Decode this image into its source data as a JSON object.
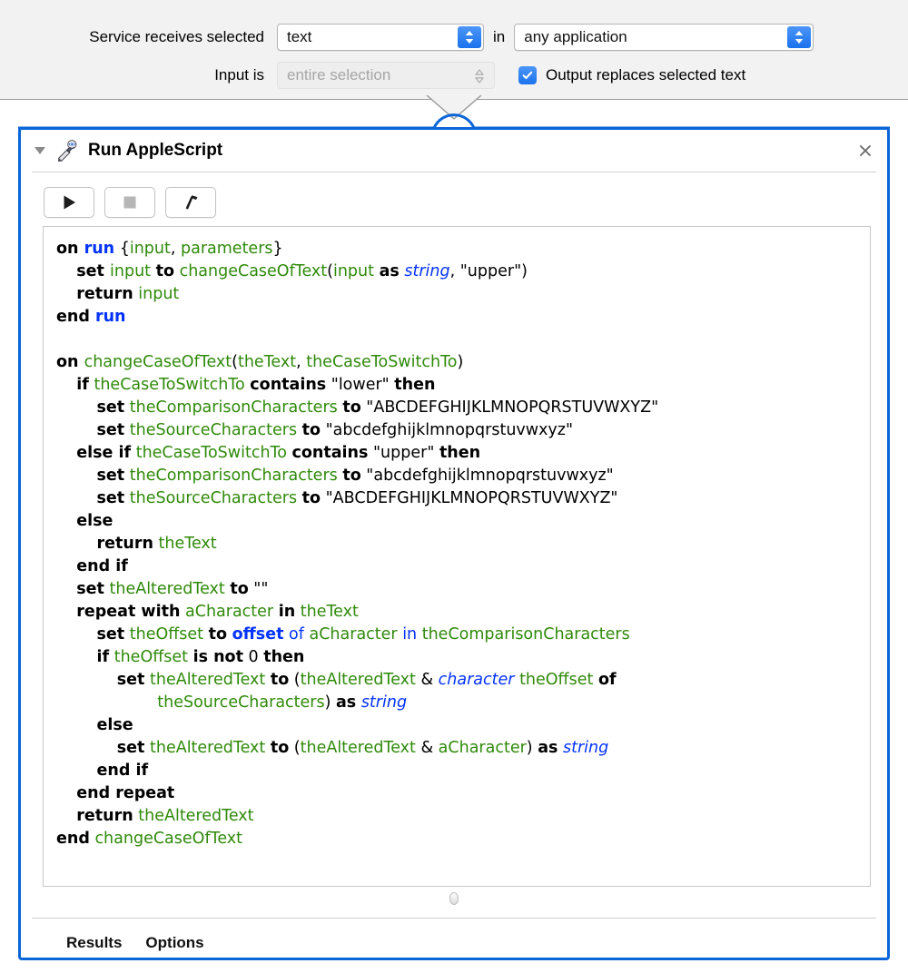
{
  "config": {
    "receives_label": "Service receives selected",
    "receives_value": "text",
    "in_label": "in",
    "application_value": "any application",
    "input_is_label": "Input is",
    "input_is_value": "entire selection",
    "output_checkbox_label": "Output replaces selected text",
    "output_checkbox_checked": true,
    "accent_color": "#1b73ee"
  },
  "panel": {
    "title": "Run AppleScript",
    "icon": "applescript-icon",
    "disclosure": "disclosure-triangle-open",
    "close_label": "✕",
    "border_color": "#0a65d8",
    "toolbar": [
      {
        "name": "run-button",
        "icon": "play-icon",
        "enabled": true
      },
      {
        "name": "stop-button",
        "icon": "stop-icon",
        "enabled": false
      },
      {
        "name": "compile-button",
        "icon": "hammer-icon",
        "enabled": true
      }
    ],
    "footer_tabs": [
      {
        "label": "Results"
      },
      {
        "label": "Options"
      }
    ]
  },
  "code": {
    "language": "AppleScript",
    "lines": [
      [
        {
          "t": "on ",
          "c": "kw"
        },
        {
          "t": "run",
          "c": "bkw"
        },
        {
          "t": " {",
          "c": "plain"
        },
        {
          "t": "input",
          "c": "var"
        },
        {
          "t": ", ",
          "c": "plain"
        },
        {
          "t": "parameters",
          "c": "var"
        },
        {
          "t": "}",
          "c": "plain"
        }
      ],
      [
        {
          "t": "    ",
          "c": "plain"
        },
        {
          "t": "set ",
          "c": "kw"
        },
        {
          "t": "input",
          "c": "var"
        },
        {
          "t": " ",
          "c": "plain"
        },
        {
          "t": "to",
          "c": "kw"
        },
        {
          "t": " ",
          "c": "plain"
        },
        {
          "t": "changeCaseOfText",
          "c": "var"
        },
        {
          "t": "(",
          "c": "plain"
        },
        {
          "t": "input",
          "c": "var"
        },
        {
          "t": " ",
          "c": "plain"
        },
        {
          "t": "as",
          "c": "kw"
        },
        {
          "t": " ",
          "c": "plain"
        },
        {
          "t": "string",
          "c": "bit"
        },
        {
          "t": ", \"upper\")",
          "c": "plain"
        }
      ],
      [
        {
          "t": "    ",
          "c": "plain"
        },
        {
          "t": "return",
          "c": "kw"
        },
        {
          "t": " ",
          "c": "plain"
        },
        {
          "t": "input",
          "c": "var"
        }
      ],
      [
        {
          "t": "end ",
          "c": "kw"
        },
        {
          "t": "run",
          "c": "bkw"
        }
      ],
      [
        {
          "t": "",
          "c": "plain"
        }
      ],
      [
        {
          "t": "on ",
          "c": "kw"
        },
        {
          "t": "changeCaseOfText",
          "c": "var"
        },
        {
          "t": "(",
          "c": "plain"
        },
        {
          "t": "theText",
          "c": "var"
        },
        {
          "t": ", ",
          "c": "plain"
        },
        {
          "t": "theCaseToSwitchTo",
          "c": "var"
        },
        {
          "t": ")",
          "c": "plain"
        }
      ],
      [
        {
          "t": "    ",
          "c": "plain"
        },
        {
          "t": "if",
          "c": "kw"
        },
        {
          "t": " ",
          "c": "plain"
        },
        {
          "t": "theCaseToSwitchTo",
          "c": "var"
        },
        {
          "t": " ",
          "c": "plain"
        },
        {
          "t": "contains",
          "c": "kw"
        },
        {
          "t": " \"lower\" ",
          "c": "plain"
        },
        {
          "t": "then",
          "c": "kw"
        }
      ],
      [
        {
          "t": "        ",
          "c": "plain"
        },
        {
          "t": "set",
          "c": "kw"
        },
        {
          "t": " ",
          "c": "plain"
        },
        {
          "t": "theComparisonCharacters",
          "c": "var"
        },
        {
          "t": " ",
          "c": "plain"
        },
        {
          "t": "to",
          "c": "kw"
        },
        {
          "t": " \"ABCDEFGHIJKLMNOPQRSTUVWXYZ\"",
          "c": "plain"
        }
      ],
      [
        {
          "t": "        ",
          "c": "plain"
        },
        {
          "t": "set",
          "c": "kw"
        },
        {
          "t": " ",
          "c": "plain"
        },
        {
          "t": "theSourceCharacters",
          "c": "var"
        },
        {
          "t": " ",
          "c": "plain"
        },
        {
          "t": "to",
          "c": "kw"
        },
        {
          "t": " \"abcdefghijklmnopqrstuvwxyz\"",
          "c": "plain"
        }
      ],
      [
        {
          "t": "    ",
          "c": "plain"
        },
        {
          "t": "else if",
          "c": "kw"
        },
        {
          "t": " ",
          "c": "plain"
        },
        {
          "t": "theCaseToSwitchTo",
          "c": "var"
        },
        {
          "t": " ",
          "c": "plain"
        },
        {
          "t": "contains",
          "c": "kw"
        },
        {
          "t": " \"upper\" ",
          "c": "plain"
        },
        {
          "t": "then",
          "c": "kw"
        }
      ],
      [
        {
          "t": "        ",
          "c": "plain"
        },
        {
          "t": "set",
          "c": "kw"
        },
        {
          "t": " ",
          "c": "plain"
        },
        {
          "t": "theComparisonCharacters",
          "c": "var"
        },
        {
          "t": " ",
          "c": "plain"
        },
        {
          "t": "to",
          "c": "kw"
        },
        {
          "t": " \"abcdefghijklmnopqrstuvwxyz\"",
          "c": "plain"
        }
      ],
      [
        {
          "t": "        ",
          "c": "plain"
        },
        {
          "t": "set",
          "c": "kw"
        },
        {
          "t": " ",
          "c": "plain"
        },
        {
          "t": "theSourceCharacters",
          "c": "var"
        },
        {
          "t": " ",
          "c": "plain"
        },
        {
          "t": "to",
          "c": "kw"
        },
        {
          "t": " \"ABCDEFGHIJKLMNOPQRSTUVWXYZ\"",
          "c": "plain"
        }
      ],
      [
        {
          "t": "    ",
          "c": "plain"
        },
        {
          "t": "else",
          "c": "kw"
        }
      ],
      [
        {
          "t": "        ",
          "c": "plain"
        },
        {
          "t": "return",
          "c": "kw"
        },
        {
          "t": " ",
          "c": "plain"
        },
        {
          "t": "theText",
          "c": "var"
        }
      ],
      [
        {
          "t": "    ",
          "c": "plain"
        },
        {
          "t": "end if",
          "c": "kw"
        }
      ],
      [
        {
          "t": "    ",
          "c": "plain"
        },
        {
          "t": "set",
          "c": "kw"
        },
        {
          "t": " ",
          "c": "plain"
        },
        {
          "t": "theAlteredText",
          "c": "var"
        },
        {
          "t": " ",
          "c": "plain"
        },
        {
          "t": "to",
          "c": "kw"
        },
        {
          "t": " \"\"",
          "c": "plain"
        }
      ],
      [
        {
          "t": "    ",
          "c": "plain"
        },
        {
          "t": "repeat with",
          "c": "kw"
        },
        {
          "t": " ",
          "c": "plain"
        },
        {
          "t": "aCharacter",
          "c": "var"
        },
        {
          "t": " ",
          "c": "plain"
        },
        {
          "t": "in",
          "c": "kw"
        },
        {
          "t": " ",
          "c": "plain"
        },
        {
          "t": "theText",
          "c": "var"
        }
      ],
      [
        {
          "t": "        ",
          "c": "plain"
        },
        {
          "t": "set",
          "c": "kw"
        },
        {
          "t": " ",
          "c": "plain"
        },
        {
          "t": "theOffset",
          "c": "var"
        },
        {
          "t": " ",
          "c": "plain"
        },
        {
          "t": "to",
          "c": "kw"
        },
        {
          "t": " ",
          "c": "plain"
        },
        {
          "t": "offset",
          "c": "bkw"
        },
        {
          "t": " ",
          "c": "plain"
        },
        {
          "t": "of",
          "c": "bpl"
        },
        {
          "t": " ",
          "c": "plain"
        },
        {
          "t": "aCharacter",
          "c": "var"
        },
        {
          "t": " ",
          "c": "plain"
        },
        {
          "t": "in",
          "c": "bpl"
        },
        {
          "t": " ",
          "c": "plain"
        },
        {
          "t": "theComparisonCharacters",
          "c": "var"
        }
      ],
      [
        {
          "t": "        ",
          "c": "plain"
        },
        {
          "t": "if",
          "c": "kw"
        },
        {
          "t": " ",
          "c": "plain"
        },
        {
          "t": "theOffset",
          "c": "var"
        },
        {
          "t": " ",
          "c": "plain"
        },
        {
          "t": "is not",
          "c": "kw"
        },
        {
          "t": " 0 ",
          "c": "plain"
        },
        {
          "t": "then",
          "c": "kw"
        }
      ],
      [
        {
          "t": "            ",
          "c": "plain"
        },
        {
          "t": "set",
          "c": "kw"
        },
        {
          "t": " ",
          "c": "plain"
        },
        {
          "t": "theAlteredText",
          "c": "var"
        },
        {
          "t": " ",
          "c": "plain"
        },
        {
          "t": "to",
          "c": "kw"
        },
        {
          "t": " (",
          "c": "plain"
        },
        {
          "t": "theAlteredText",
          "c": "var"
        },
        {
          "t": " & ",
          "c": "plain"
        },
        {
          "t": "character",
          "c": "bit"
        },
        {
          "t": " ",
          "c": "plain"
        },
        {
          "t": "theOffset",
          "c": "var"
        },
        {
          "t": " ",
          "c": "plain"
        },
        {
          "t": "of",
          "c": "kw"
        }
      ],
      [
        {
          "t": "                    ",
          "c": "plain"
        },
        {
          "t": "theSourceCharacters",
          "c": "var"
        },
        {
          "t": ") ",
          "c": "plain"
        },
        {
          "t": "as",
          "c": "kw"
        },
        {
          "t": " ",
          "c": "plain"
        },
        {
          "t": "string",
          "c": "bit"
        }
      ],
      [
        {
          "t": "        ",
          "c": "plain"
        },
        {
          "t": "else",
          "c": "kw"
        }
      ],
      [
        {
          "t": "            ",
          "c": "plain"
        },
        {
          "t": "set",
          "c": "kw"
        },
        {
          "t": " ",
          "c": "plain"
        },
        {
          "t": "theAlteredText",
          "c": "var"
        },
        {
          "t": " ",
          "c": "plain"
        },
        {
          "t": "to",
          "c": "kw"
        },
        {
          "t": " (",
          "c": "plain"
        },
        {
          "t": "theAlteredText",
          "c": "var"
        },
        {
          "t": " & ",
          "c": "plain"
        },
        {
          "t": "aCharacter",
          "c": "var"
        },
        {
          "t": ") ",
          "c": "plain"
        },
        {
          "t": "as",
          "c": "kw"
        },
        {
          "t": " ",
          "c": "plain"
        },
        {
          "t": "string",
          "c": "bit"
        }
      ],
      [
        {
          "t": "        ",
          "c": "plain"
        },
        {
          "t": "end if",
          "c": "kw"
        }
      ],
      [
        {
          "t": "    ",
          "c": "plain"
        },
        {
          "t": "end repeat",
          "c": "kw"
        }
      ],
      [
        {
          "t": "    ",
          "c": "plain"
        },
        {
          "t": "return",
          "c": "kw"
        },
        {
          "t": " ",
          "c": "plain"
        },
        {
          "t": "theAlteredText",
          "c": "var"
        }
      ],
      [
        {
          "t": "end",
          "c": "kw"
        },
        {
          "t": " ",
          "c": "plain"
        },
        {
          "t": "changeCaseOfText",
          "c": "var"
        }
      ]
    ]
  }
}
